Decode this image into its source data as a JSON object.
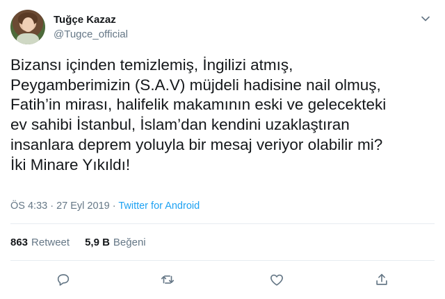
{
  "tweet": {
    "author": {
      "display_name": "Tuğçe Kazaz",
      "handle": "@Tugce_official"
    },
    "text": "Bizansı içinden temizlemiş, İngilizi atmış,\nPeygamberimizin (S.A.V) müjdeli hadisine nail olmuş,\nFatih’in mirası, halifelik makamının eski ve gelecekteki\nev sahibi İstanbul, İslam’dan kendini uzaklaştıran\ninsanlara deprem yoluyla bir mesaj veriyor olabilir mi?\nİki Minare Yıkıldı!",
    "meta": {
      "time": "ÖS 4:33",
      "separator1": " · ",
      "date": "27 Eyl 2019",
      "separator2": " · ",
      "source": "Twitter for Android"
    },
    "stats": {
      "retweets_count": "863",
      "retweets_label": "Retweet",
      "likes_count": "5,9 B",
      "likes_label": "Beğeni"
    },
    "actions": [
      "reply-icon",
      "retweet-icon",
      "like-icon",
      "share-icon"
    ],
    "colors": {
      "link": "#1da1f2",
      "secondary_text": "#657786",
      "divider": "#e6ecf0"
    }
  }
}
